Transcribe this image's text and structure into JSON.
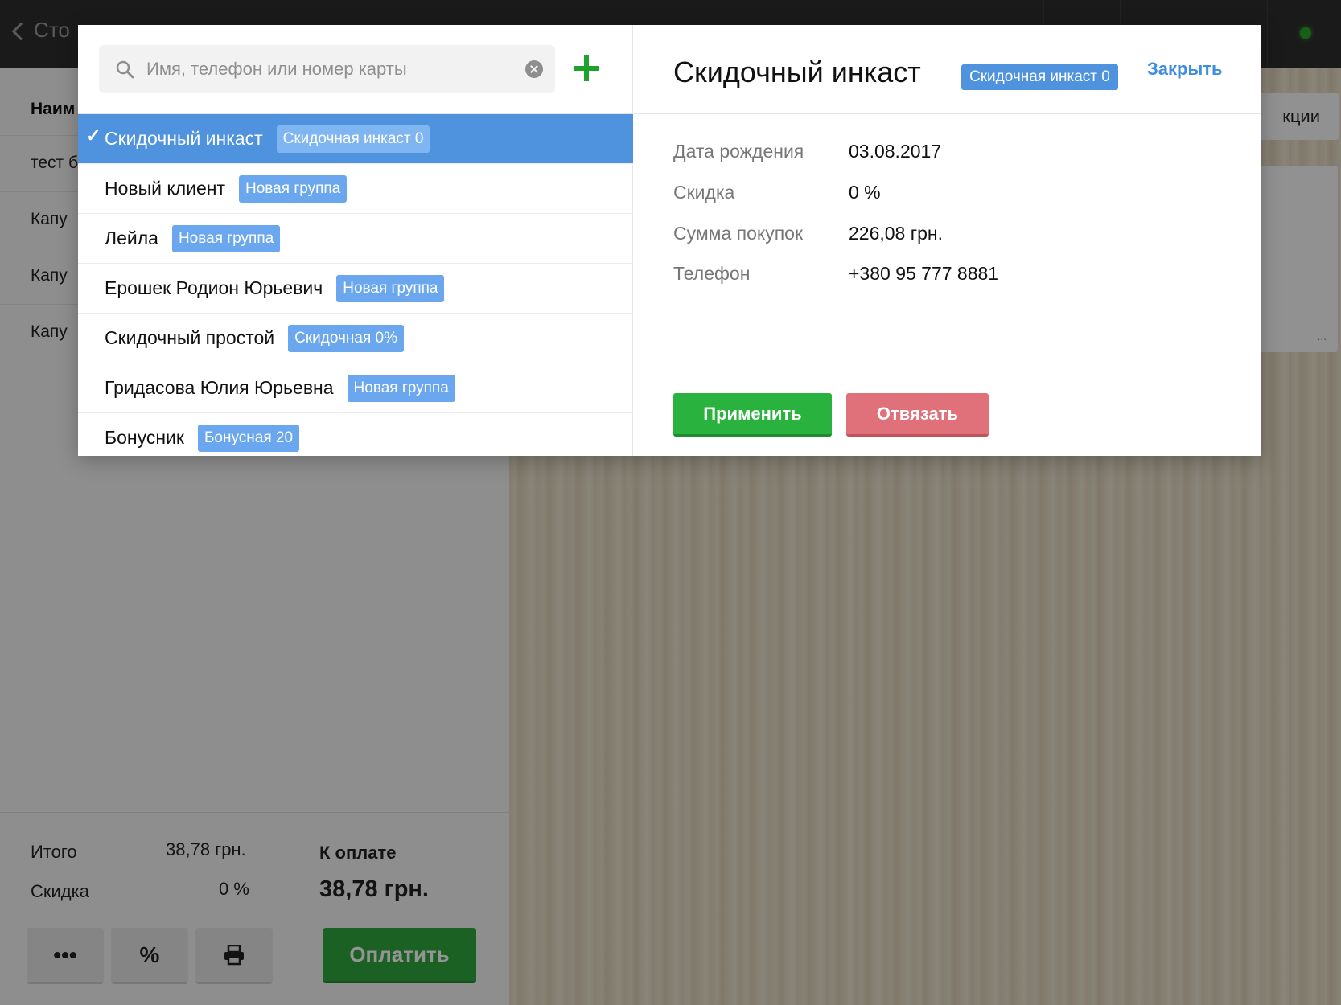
{
  "background": {
    "topbar": {
      "back_label": "Сто"
    },
    "orders": {
      "column_header": "Наим",
      "rows": [
        "тест б",
        "Капу",
        "Капу",
        "Капу"
      ]
    },
    "footer": {
      "total_label": "Итого",
      "total_value": "38,78 грн.",
      "discount_label": "Скидка",
      "discount_value": "0 %",
      "to_pay_label": "К оплате",
      "to_pay_value": "38,78 грн.",
      "more_label": "•••",
      "percent_label": "%",
      "pay_label": "Оплатить"
    },
    "right_button_label": "кции",
    "right_card_label": "..."
  },
  "search": {
    "placeholder": "Имя, телефон или номер карты",
    "value": ""
  },
  "clients": [
    {
      "name": "Скидочный инкаст",
      "group": "Скидочная инкаст 0",
      "selected": true
    },
    {
      "name": "Новый клиент",
      "group": "Новая группа",
      "selected": false
    },
    {
      "name": "Лейла",
      "group": "Новая группа",
      "selected": false
    },
    {
      "name": "Ерошек Родион Юрьевич",
      "group": "Новая группа",
      "selected": false
    },
    {
      "name": "Скидочный простой",
      "group": "Скидочная 0%",
      "selected": false
    },
    {
      "name": "Гридасова Юлия Юрьевна",
      "group": "Новая группа",
      "selected": false
    },
    {
      "name": "Бонусник",
      "group": "Бонусная 20",
      "selected": false
    }
  ],
  "detail": {
    "title": "Скидочный инкаст",
    "group_badge": "Скидочная инкаст 0",
    "close_label": "Закрыть",
    "fields": [
      {
        "label": "Дата рождения",
        "value": "03.08.2017"
      },
      {
        "label": "Скидка",
        "value": "0 %"
      },
      {
        "label": "Сумма покупок",
        "value": "226,08 грн."
      },
      {
        "label": "Телефон",
        "value": "+380 95 777 8881"
      }
    ],
    "apply_label": "Применить",
    "unlink_label": "Отвязать"
  },
  "icons": {
    "search": "search-icon",
    "clear": "clear-icon",
    "add": "plus-icon",
    "check": "checkmark-icon",
    "print": "printer-icon",
    "back": "chevron-left-icon"
  },
  "colors": {
    "selected_row": "#4f93df",
    "badge": "#6aa7ee",
    "apply": "#29b23d",
    "unlink": "#e0707a",
    "close_link": "#3f8de0",
    "add_icon": "#1da22b"
  }
}
